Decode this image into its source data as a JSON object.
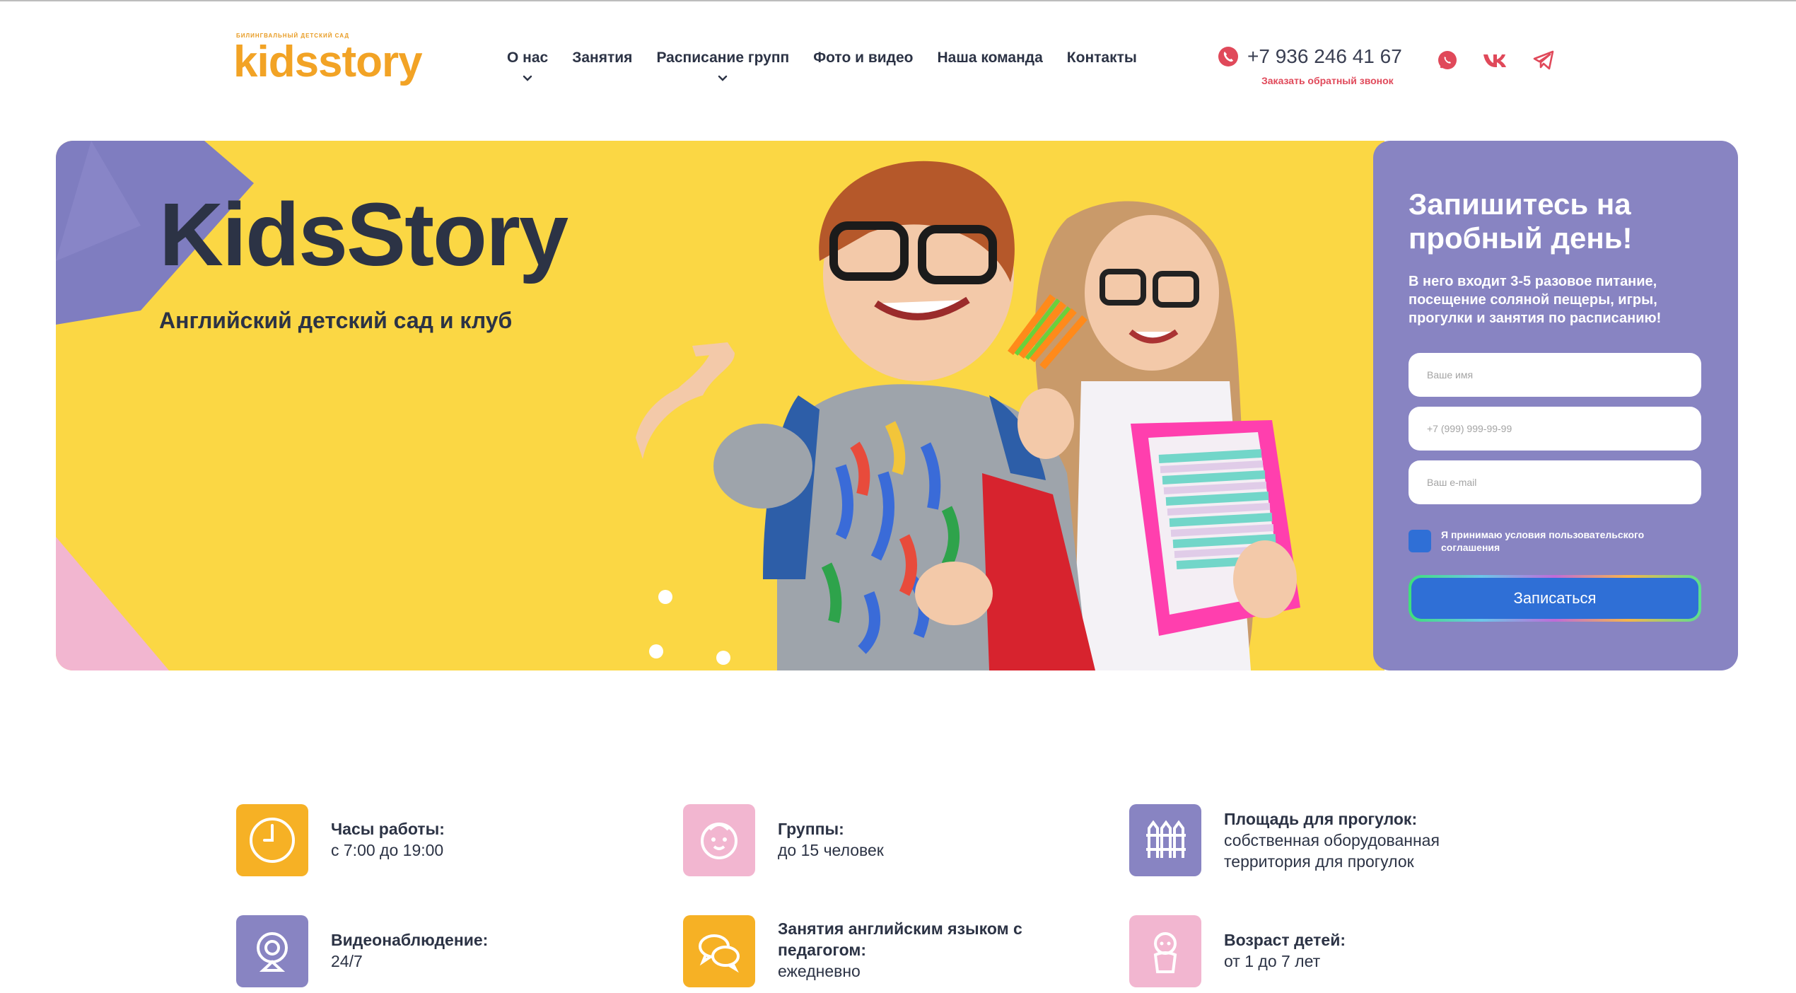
{
  "header": {
    "logo_small": "БИЛИНГВАЛЬНЫЙ ДЕТСКИЙ САД",
    "logo_kids": "kids",
    "logo_story": "story",
    "nav": [
      {
        "label": "О нас",
        "has_dropdown": true
      },
      {
        "label": "Занятия",
        "has_dropdown": false
      },
      {
        "label": "Расписание групп",
        "has_dropdown": true
      },
      {
        "label": "Фото и видео",
        "has_dropdown": false
      },
      {
        "label": "Наша команда",
        "has_dropdown": false
      },
      {
        "label": "Контакты",
        "has_dropdown": false
      }
    ],
    "phone": "+7 936 246 41 67",
    "callback": "Заказать обратный звонок",
    "social_icons": [
      "whatsapp-icon",
      "vk-icon",
      "telegram-icon"
    ]
  },
  "hero": {
    "title": "KidsStory",
    "subtitle": "Английский детский сад и клуб",
    "image_subject": "two smiling children in glasses holding notebooks and pencils"
  },
  "form": {
    "title": "Запишитесь на пробный день!",
    "description": "В него входит 3-5 разовое питание, посещение соляной пещеры, игры, прогулки и занятия по расписанию!",
    "name_placeholder": "Ваше имя",
    "phone_placeholder": "+7 (999) 999-99-99",
    "email_placeholder": "Ваш e-mail",
    "agreement": "Я принимаю условия пользовательского соглашения",
    "submit": "Записаться"
  },
  "features": [
    {
      "title": "Часы работы:",
      "value": "с 7:00 до 19:00",
      "icon": "clock-icon"
    },
    {
      "title": "Группы:",
      "value": "до 15 человек",
      "icon": "child-face-icon"
    },
    {
      "title": "Площадь для прогулок:",
      "value": "собственная оборудованная территория для прогулок",
      "icon": "fence-icon"
    },
    {
      "title": "Видеонаблюдение:",
      "value": "24/7",
      "icon": "webcam-icon"
    },
    {
      "title": "Занятия английским языком с педагогом:",
      "value": "ежедневно",
      "icon": "chat-bubbles-icon"
    },
    {
      "title": "Возраст детей:",
      "value": "от 1 до 7 лет",
      "icon": "baby-icon"
    }
  ],
  "colors": {
    "yellow": "#fbd744",
    "purple": "#8884c2",
    "orange": "#f6b125",
    "pink": "#f2b6d0",
    "dark": "#2c3345",
    "accent_red": "#e0495a",
    "button_blue": "#2f6fd6"
  }
}
